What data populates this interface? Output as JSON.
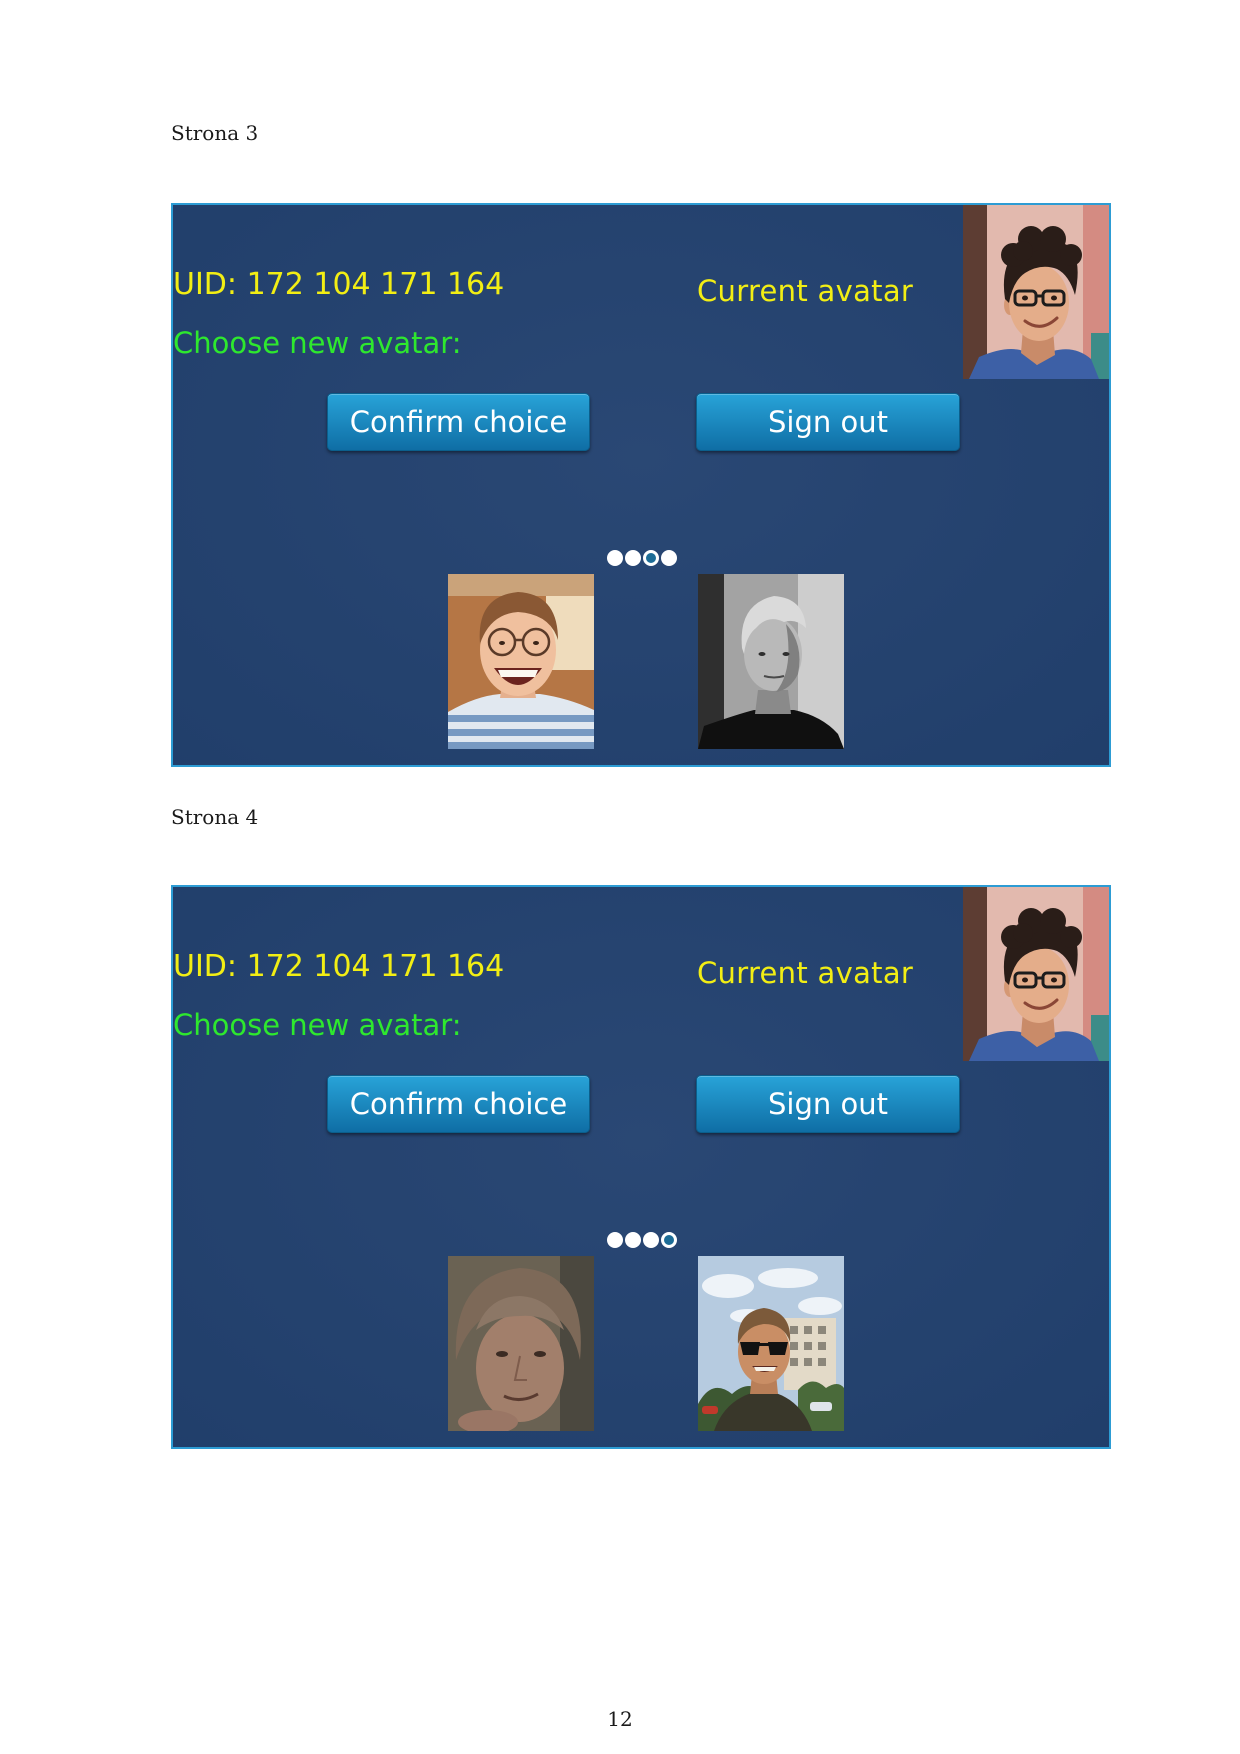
{
  "page_number": "12",
  "colors": {
    "panel_background": "#22416f",
    "panel_border": "#2d9cd4",
    "uid_text": "#f2ee14",
    "current_avatar_text": "#f2ee14",
    "choose_text": "#2ee82e",
    "button_top": "#28a3d8",
    "button_bottom": "#0f6ea5",
    "button_text": "#ffffff",
    "pager_dot": "#ffffff"
  },
  "screens": [
    {
      "caption": "Strona 3",
      "uid_label": "UID:",
      "uid_value": "172 104 171 164",
      "current_avatar_label": "Current avatar",
      "choose_label": "Choose new avatar:",
      "confirm_button_label": "Confirm choice",
      "sign_out_button_label": "Sign out",
      "pager": {
        "count": 4,
        "current": 3
      }
    },
    {
      "caption": "Strona 4",
      "uid_label": "UID:",
      "uid_value": "172 104 171 164",
      "current_avatar_label": "Current avatar",
      "choose_label": "Choose new avatar:",
      "confirm_button_label": "Confirm choice",
      "sign_out_button_label": "Sign out",
      "pager": {
        "count": 4,
        "current": 4
      }
    }
  ]
}
